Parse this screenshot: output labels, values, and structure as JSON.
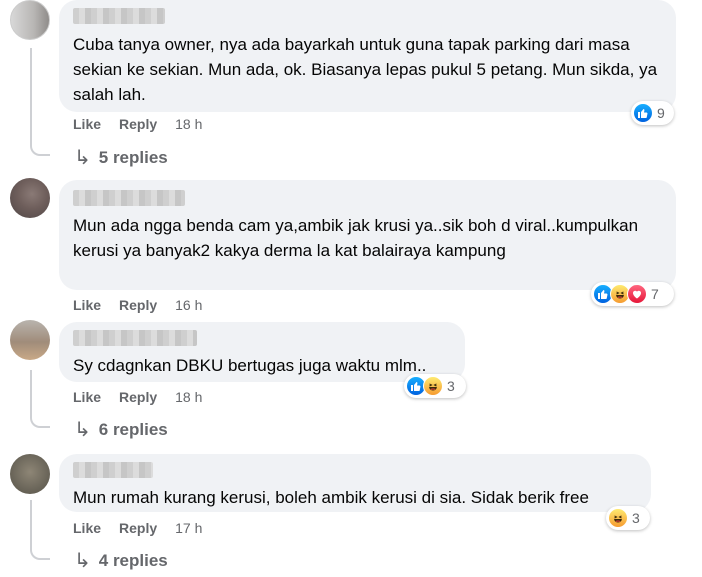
{
  "ui": {
    "like_label": "Like",
    "reply_label": "Reply"
  },
  "comments": [
    {
      "text": "Cuba tanya owner, nya ada bayarkah untuk guna tapak parking dari masa sekian ke sekian. Mun ada, ok. Biasanya lepas pukul 5 petang. Mun sikda, ya salah lah.",
      "time": "18 h",
      "reaction_count": "9",
      "reactions": [
        "like"
      ],
      "replies": "5 replies"
    },
    {
      "text": "Mun ada ngga benda cam ya,ambik jak krusi ya..sik boh d viral..kumpulkan kerusi ya banyak2 kakya derma la kat balairaya kampung",
      "time": "16 h",
      "reaction_count": "7",
      "reactions": [
        "like",
        "haha",
        "love"
      ]
    },
    {
      "text": "Sy cdagnkan DBKU bertugas juga waktu mlm..",
      "time": "18 h",
      "reaction_count": "3",
      "reactions": [
        "like",
        "haha"
      ],
      "replies": "6 replies"
    },
    {
      "text": "Mun rumah kurang kerusi, boleh ambik kerusi di sia. Sidak berik free",
      "time": "17 h",
      "reaction_count": "3",
      "reactions": [
        "haha"
      ],
      "replies": "4 replies"
    }
  ],
  "icons": {
    "reply_arrow": "reply-arrow-icon",
    "like": "like-reaction-icon",
    "haha": "haha-reaction-icon",
    "love": "love-reaction-icon"
  },
  "colors": {
    "bubble": "#f0f2f5",
    "meta_text": "#65676b",
    "like_blue": "#0866ff"
  }
}
